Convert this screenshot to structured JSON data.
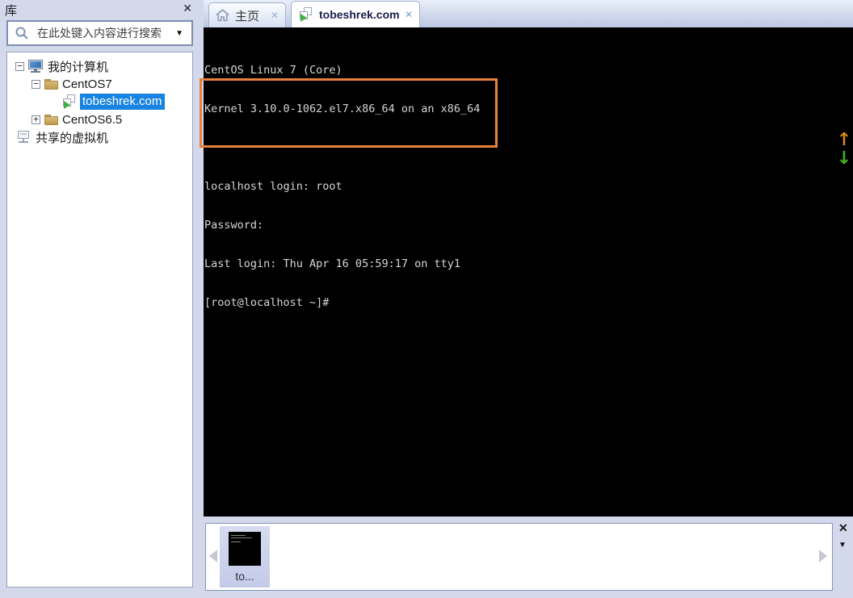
{
  "sidebar": {
    "title": "库",
    "close_icon": "✕",
    "search": {
      "placeholder": "在此处键入内容进行搜索",
      "dropdown_icon": "▼"
    },
    "tree": {
      "items": [
        {
          "label": "我的计算机",
          "expander": "−",
          "icon": "computer-icon",
          "selected": false
        },
        {
          "label": "CentOS7",
          "expander": "−",
          "icon": "folder-icon",
          "selected": false
        },
        {
          "label": "tobeshrek.com",
          "expander": "",
          "icon": "vm-icon",
          "selected": true
        },
        {
          "label": "CentOS6.5",
          "expander": "+",
          "icon": "folder-icon",
          "selected": false
        },
        {
          "label": "共享的虚拟机",
          "expander": "",
          "icon": "shared-vm-icon",
          "selected": false
        }
      ]
    }
  },
  "tabs": {
    "home": {
      "label": "主页",
      "icon": "home-icon",
      "close_icon": "✕"
    },
    "vm": {
      "label": "tobeshrek.com",
      "icon": "vm-icon",
      "close_icon": "✕"
    }
  },
  "console": {
    "lines": [
      "CentOS Linux 7 (Core)",
      "Kernel 3.10.0-1062.el7.x86_64 on an x86_64",
      "",
      "localhost login: root",
      "Password:",
      "Last login: Thu Apr 16 05:59:17 on tty1",
      "[root@localhost ~]#"
    ]
  },
  "annotations": {
    "highlight_box_color": "#e8813b",
    "up_arrow": {
      "glyph": "↑",
      "color": "#d8871c"
    },
    "down_arrow": {
      "glyph": "↓",
      "color": "#46b01e"
    }
  },
  "thumbnail_bar": {
    "thumb_label": "to...",
    "close_icon": "✕",
    "dropdown_icon": "▼"
  },
  "colors": {
    "background": "#d3d8eb",
    "selection_blue": "#1883e0",
    "terminal_text": "#d5d5d5",
    "folder_tan": "#cba760"
  }
}
